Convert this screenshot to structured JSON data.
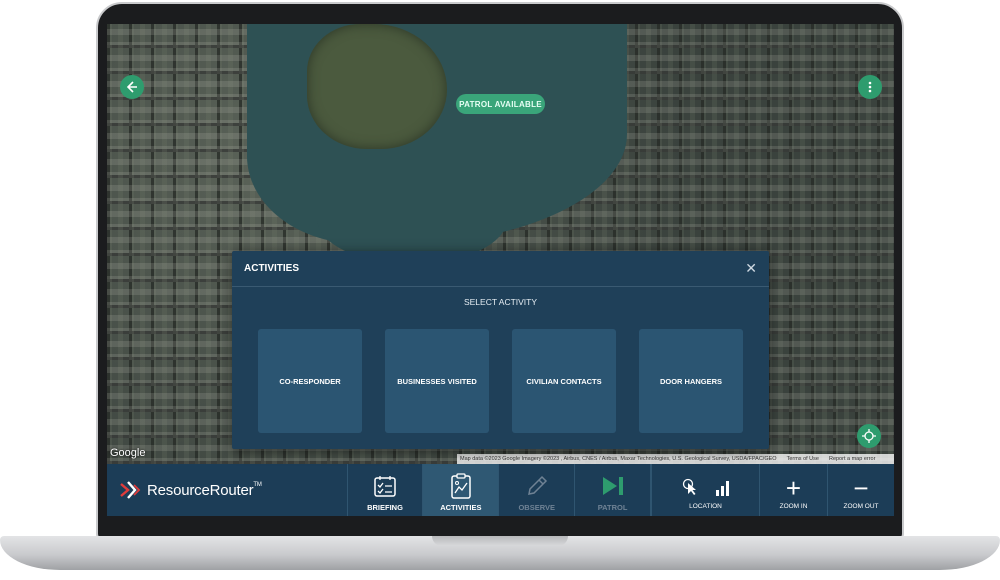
{
  "map": {
    "patrol_label": "PATROL AVAILABLE",
    "google_label": "Google",
    "attribution": "Map data ©2023 Google Imagery ©2023 , Airbus, CNES / Airbus, Maxar Technologies, U.S. Geological Survey, USDA/FPAC/GEO",
    "terms": "Terms of Use",
    "report": "Report a map error",
    "accent_color": "#2e9c6e"
  },
  "modal": {
    "title": "ACTIVITIES",
    "close_glyph": "✕",
    "subtitle": "SELECT ACTIVITY",
    "cards": [
      "CO-RESPONDER",
      "BUSINESSES VISITED",
      "CIVILIAN CONTACTS",
      "DOOR HANGERS"
    ]
  },
  "toolbar": {
    "brand": "ResourceRouter",
    "brand_tm": "TM",
    "tabs": [
      {
        "label": "BRIEFING",
        "icon": "calendar-checklist-icon"
      },
      {
        "label": "ACTIVITIES",
        "icon": "clipboard-chart-icon"
      },
      {
        "label": "OBSERVE",
        "icon": "pencil-icon"
      },
      {
        "label": "PATROL",
        "icon": "play-next-icon"
      }
    ],
    "location_label": "LOCATION",
    "zoom_in_label": "ZOOM IN",
    "zoom_out_label": "ZOOM OUT",
    "zoom_in_glyph": "+",
    "zoom_out_glyph": "−"
  }
}
